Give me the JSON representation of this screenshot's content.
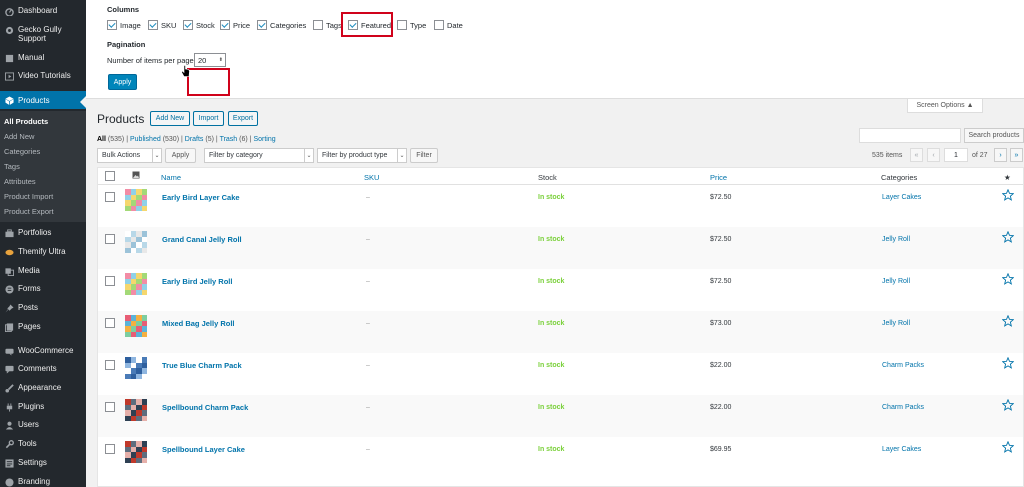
{
  "sidebar": {
    "items": [
      {
        "label": "Dashboard",
        "icon": "dashboard-icon"
      },
      {
        "label": "Gecko Gully Support",
        "icon": "support-icon"
      },
      {
        "label": "Manual",
        "icon": "manual-icon"
      },
      {
        "label": "Video Tutorials",
        "icon": "video-icon"
      },
      {
        "label": "Products",
        "icon": "products-icon"
      },
      {
        "label": "Portfolios",
        "icon": "portfolio-icon"
      },
      {
        "label": "Themify Ultra",
        "icon": "themify-icon"
      },
      {
        "label": "Media",
        "icon": "media-icon"
      },
      {
        "label": "Forms",
        "icon": "forms-icon"
      },
      {
        "label": "Posts",
        "icon": "pin-icon"
      },
      {
        "label": "Pages",
        "icon": "pages-icon"
      },
      {
        "label": "WooCommerce",
        "icon": "woocommerce-icon"
      },
      {
        "label": "Comments",
        "icon": "comment-icon"
      },
      {
        "label": "Appearance",
        "icon": "brush-icon"
      },
      {
        "label": "Plugins",
        "icon": "plugin-icon"
      },
      {
        "label": "Users",
        "icon": "user-icon"
      },
      {
        "label": "Tools",
        "icon": "wrench-icon"
      },
      {
        "label": "Settings",
        "icon": "settings-icon"
      },
      {
        "label": "Branding",
        "icon": "branding-icon"
      }
    ],
    "submenu": [
      "All Products",
      "Add New",
      "Categories",
      "Tags",
      "Attributes",
      "Product Import",
      "Product Export"
    ]
  },
  "screen_options": {
    "columns_heading": "Columns",
    "columns": [
      {
        "label": "Image",
        "checked": true
      },
      {
        "label": "SKU",
        "checked": true
      },
      {
        "label": "Stock",
        "checked": true
      },
      {
        "label": "Price",
        "checked": true
      },
      {
        "label": "Categories",
        "checked": true
      },
      {
        "label": "Tags",
        "checked": false
      },
      {
        "label": "Featured",
        "checked": true
      },
      {
        "label": "Type",
        "checked": false
      },
      {
        "label": "Date",
        "checked": false
      }
    ],
    "pagination_heading": "Pagination",
    "per_page_label": "Number of items per page:",
    "per_page_value": "20",
    "apply_label": "Apply",
    "tab_label": "Screen Options ▲"
  },
  "header": {
    "title": "Products",
    "add_new": "Add New",
    "import": "Import",
    "export": "Export",
    "search_button": "Search products"
  },
  "views": {
    "all": "All",
    "all_count": "(535)",
    "published": "Published",
    "published_count": "(530)",
    "drafts": "Drafts",
    "drafts_count": "(5)",
    "trash": "Trash",
    "trash_count": "(6)",
    "sorting": "Sorting",
    "sep": "|"
  },
  "filters": {
    "bulk_actions": "Bulk Actions",
    "apply": "Apply",
    "category": "Filter by category",
    "product_type": "Filter by product type",
    "filter": "Filter"
  },
  "pagination": {
    "items": "535 items",
    "first": "«",
    "prev": "‹",
    "current": "1",
    "of": "of 27",
    "next": "›",
    "last": "»"
  },
  "table": {
    "columns": {
      "name": "Name",
      "sku": "SKU",
      "stock": "Stock",
      "price": "Price",
      "categories": "Categories",
      "featured": "★"
    },
    "rows": [
      {
        "name": "Early Bird Layer Cake",
        "sku": "–",
        "stock": "In stock",
        "price": "$72.50",
        "category": "Layer Cakes",
        "thumb": [
          "#f28ca5",
          "#8fd1e8",
          "#f5d76e",
          "#a3d977"
        ]
      },
      {
        "name": "Grand Canal Jelly Roll",
        "sku": "–",
        "stock": "In stock",
        "price": "$72.50",
        "category": "Jelly Roll",
        "thumb": [
          "#ffffff",
          "#b8d8e8",
          "#e8e8e8",
          "#9cc3d9"
        ]
      },
      {
        "name": "Early Bird Jelly Roll",
        "sku": "–",
        "stock": "In stock",
        "price": "$72.50",
        "category": "Jelly Roll",
        "thumb": [
          "#f28ca5",
          "#8fd1e8",
          "#f5d76e",
          "#a3d977"
        ]
      },
      {
        "name": "Mixed Bag Jelly Roll",
        "sku": "–",
        "stock": "In stock",
        "price": "$73.00",
        "category": "Jelly Roll",
        "thumb": [
          "#e85d75",
          "#5bb3d8",
          "#f5b041",
          "#7dcea0"
        ]
      },
      {
        "name": "True Blue Charm Pack",
        "sku": "–",
        "stock": "In stock",
        "price": "$22.00",
        "category": "Charm Packs",
        "thumb": [
          "#2e5f9e",
          "#8fb6e0",
          "#ffffff",
          "#4a7bb7"
        ]
      },
      {
        "name": "Spellbound Charm Pack",
        "sku": "–",
        "stock": "In stock",
        "price": "$22.00",
        "category": "Charm Packs",
        "thumb": [
          "#c0392b",
          "#5d6d7e",
          "#e6b0aa",
          "#2e4053"
        ]
      },
      {
        "name": "Spellbound Layer Cake",
        "sku": "–",
        "stock": "In stock",
        "price": "$69.95",
        "category": "Layer Cakes",
        "thumb": [
          "#c0392b",
          "#5d6d7e",
          "#e6b0aa",
          "#2e4053"
        ]
      }
    ]
  },
  "colors": {
    "accent": "#0073aa",
    "stock": "#7ad03a",
    "highlight": "#d0021b"
  }
}
